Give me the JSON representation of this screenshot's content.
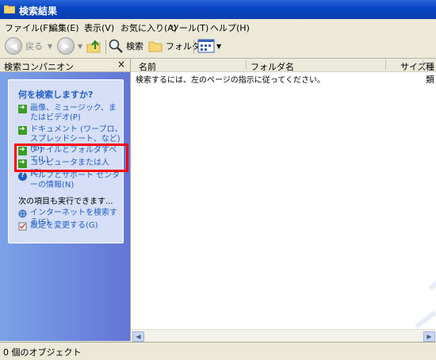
{
  "window": {
    "title": "検索結果"
  },
  "menu": [
    "ファイル(F)",
    "編集(E)",
    "表示(V)",
    "お気に入り(A)",
    "ツール(T)",
    "ヘルプ(H)"
  ],
  "toolbar": {
    "back_label": "戻る",
    "search_label": "検索",
    "folder_label": "フォルダ"
  },
  "companion": {
    "header": "検索コンパニオン",
    "close": "×",
    "question": "何を検索しますか?",
    "items": [
      "画像、ミュージック、またはビデオ(P)",
      "ドキュメント (ワープロ、スプレッドシート、など)(O)",
      "ファイルとフォルダすべて(L)",
      "コンピュータまたは人(C)",
      "ヘルプとサポート センターの情報(N)"
    ],
    "more_label": "次の項目も実行できます...",
    "more_items": [
      "インターネットを検索する(S)",
      "設定を変更する(G)"
    ]
  },
  "columns": [
    "名前",
    "フォルダ名",
    "サイズ",
    "種類"
  ],
  "message": "検索するには、左のページの指示に従ってください。",
  "status": "0 個のオブジェクト",
  "colors": {
    "title_blue": "#0a46c4",
    "task_blue": "#215dc6",
    "highlight": "#ff0000"
  }
}
